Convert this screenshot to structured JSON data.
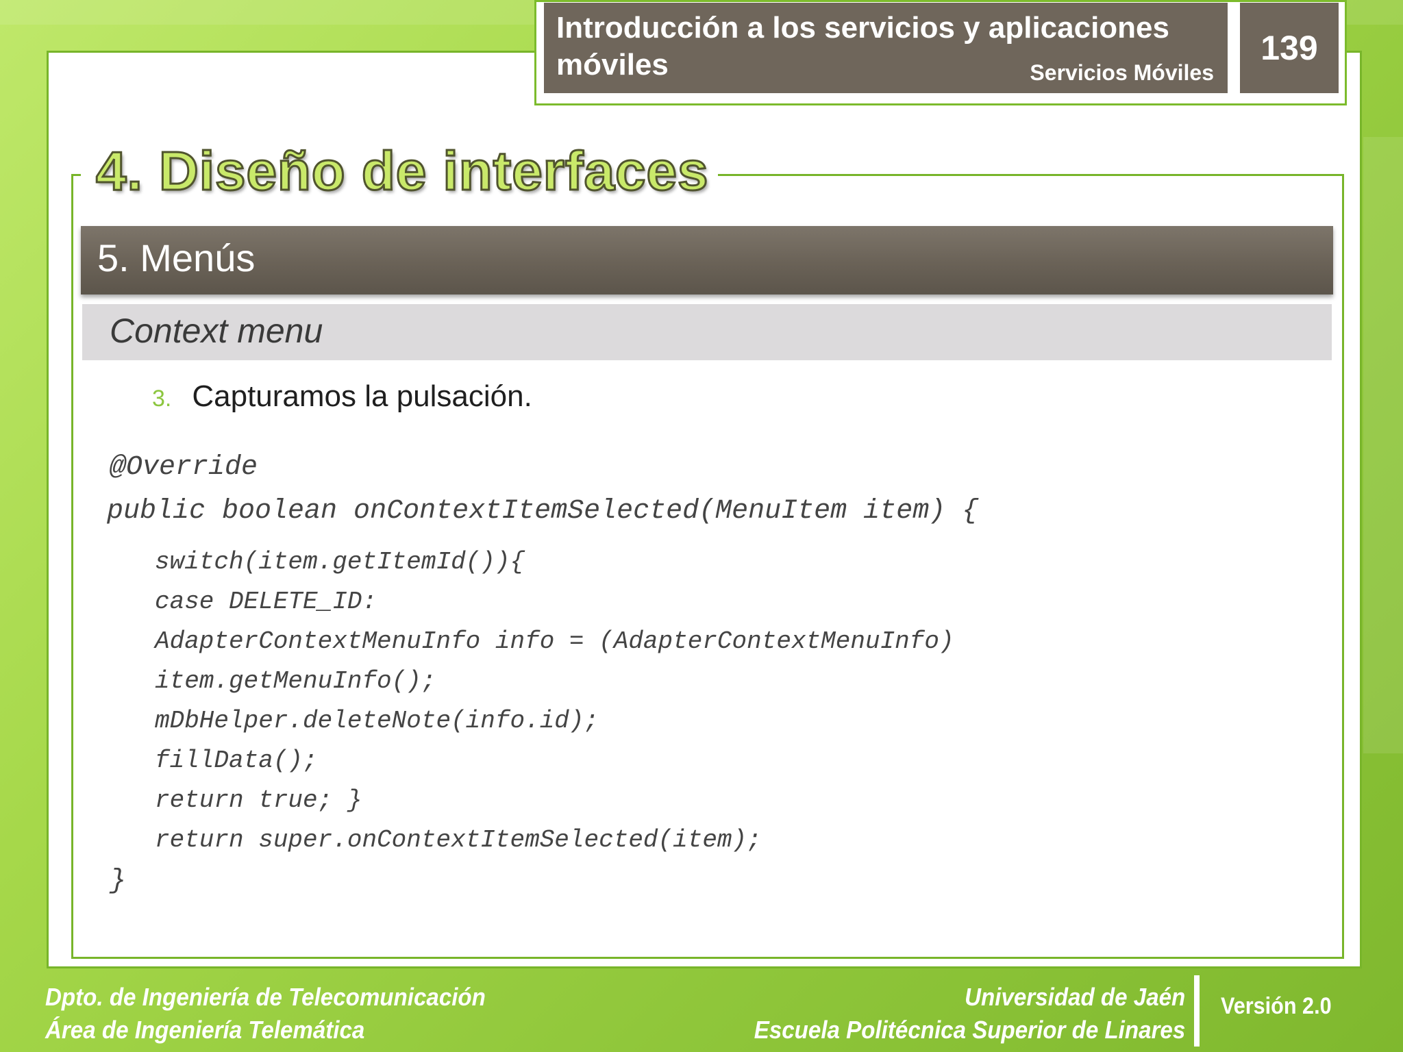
{
  "header": {
    "title_line1": "Introducción a los servicios y aplicaciones",
    "title_line2": "móviles",
    "subtitle": "Servicios Móviles",
    "page_number": "139"
  },
  "main_title": "4. Diseño de interfaces",
  "section": "5. Menús",
  "subsection": "Context menu",
  "step": {
    "number": "3.",
    "text": "Capturamos la pulsación."
  },
  "code_lines": [
    "@Override",
    "public boolean onContextItemSelected(MenuItem item) {",
    "switch(item.getItemId()){",
    "case DELETE_ID:",
    "AdapterContextMenuInfo info = (AdapterContextMenuInfo)",
    "item.getMenuInfo();",
    "mDbHelper.deleteNote(info.id);",
    "fillData();",
    "return true; }",
    "return super.onContextItemSelected(item);",
    "}"
  ],
  "footer": {
    "left_line1": "Dpto. de Ingeniería de Telecomunicación",
    "left_line2": "Área de Ingeniería Telemática",
    "right_line1": "Universidad de Jaén",
    "right_line2": "Escuela Politécnica Superior de Linares",
    "version": "Versión 2.0"
  },
  "colors": {
    "accent_green": "#8cc63f",
    "header_brown": "#6f665b",
    "subbar_gray": "#dcdadc"
  }
}
